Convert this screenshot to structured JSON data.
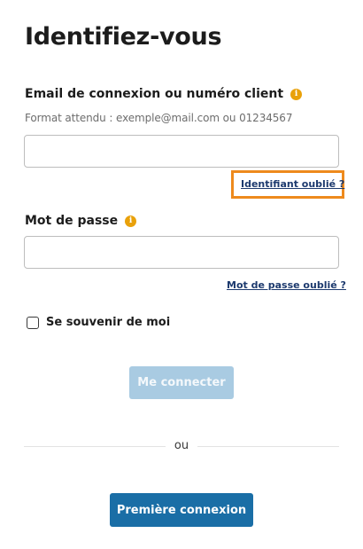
{
  "title": "Identifiez-vous",
  "login": {
    "label": "Email de connexion ou numéro client",
    "hint": "Format attendu : exemple@mail.com ou 01234567",
    "value": "",
    "forgot_link": "Identifiant oublié ?"
  },
  "password": {
    "label": "Mot de passe",
    "value": "",
    "forgot_link": "Mot de passe oublié ?"
  },
  "remember_me": {
    "label": "Se souvenir de moi",
    "checked": false
  },
  "buttons": {
    "login": "Me connecter",
    "first_login": "Première connexion"
  },
  "separator_text": "ou",
  "icons": {
    "info": "info-icon"
  },
  "colors": {
    "info_icon": "#e9a10a",
    "link": "#1d3a6e",
    "highlight": "#ee8a1d",
    "button_disabled": "#a9cbe2",
    "button_primary": "#1a6ea6"
  }
}
